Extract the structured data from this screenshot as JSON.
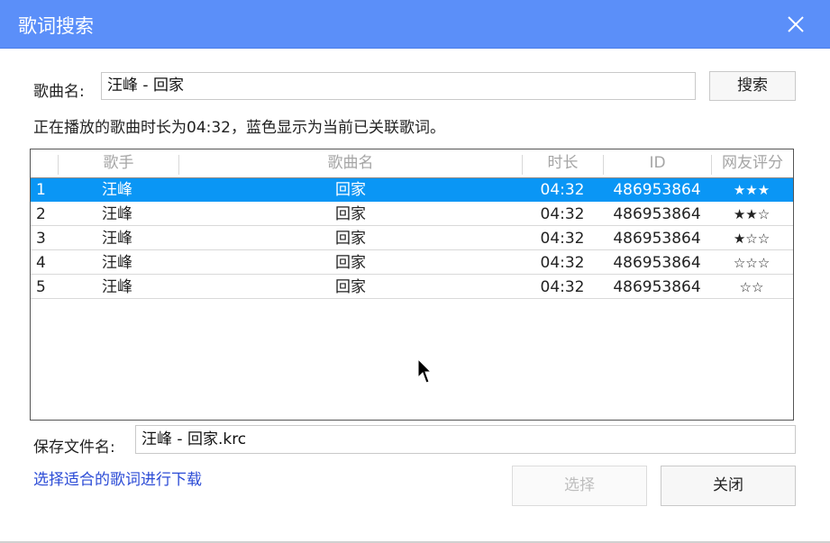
{
  "window": {
    "title": "歌词搜索"
  },
  "search": {
    "label": "歌曲名:",
    "value": "汪峰 - 回家",
    "button_label": "搜索"
  },
  "info_text": "正在播放的歌曲时长为04:32，蓝色显示为当前已关联歌词。",
  "table": {
    "headers": {
      "artist": "歌手",
      "song": "歌曲名",
      "duration": "时长",
      "id": "ID",
      "rating": "网友评分"
    },
    "rows": [
      {
        "num": "1",
        "artist": "汪峰",
        "song": "回家",
        "duration": "04:32",
        "id": "486953864",
        "rating": "★★★",
        "selected": true
      },
      {
        "num": "2",
        "artist": "汪峰",
        "song": "回家",
        "duration": "04:32",
        "id": "486953864",
        "rating": "★★☆",
        "selected": false
      },
      {
        "num": "3",
        "artist": "汪峰",
        "song": "回家",
        "duration": "04:32",
        "id": "486953864",
        "rating": "★☆☆",
        "selected": false
      },
      {
        "num": "4",
        "artist": "汪峰",
        "song": "回家",
        "duration": "04:32",
        "id": "486953864",
        "rating": "☆☆☆",
        "selected": false
      },
      {
        "num": "5",
        "artist": "汪峰",
        "song": "回家",
        "duration": "04:32",
        "id": "486953864",
        "rating": "☆☆",
        "selected": false
      }
    ]
  },
  "save": {
    "label": "保存文件名:",
    "value": "汪峰 - 回家.krc"
  },
  "hint_link": "选择适合的歌词进行下载",
  "buttons": {
    "select": "选择",
    "close": "关闭"
  },
  "colors": {
    "titlebar": "#5b8ff9",
    "selection": "#0a96f5",
    "link": "#2b4bd6"
  }
}
